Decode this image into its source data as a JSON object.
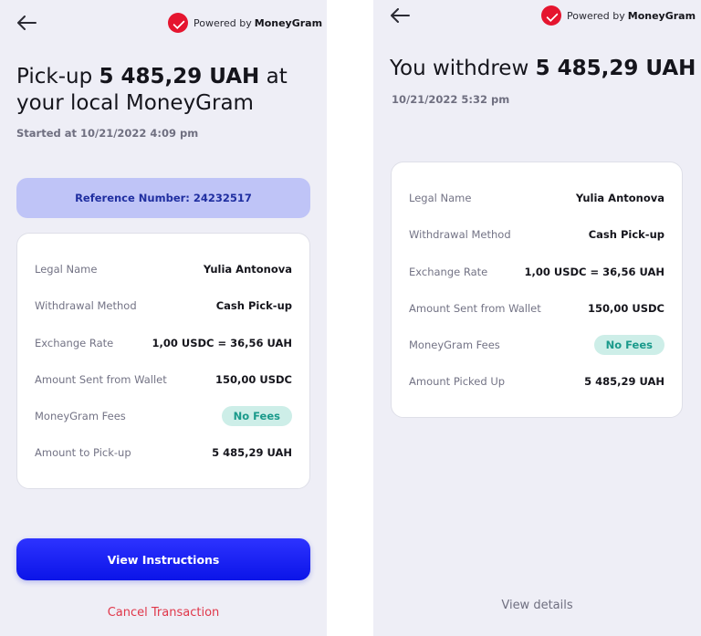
{
  "brand": {
    "powered_by": "Powered by",
    "name": "MoneyGram"
  },
  "left": {
    "title_pre": "Pick-up ",
    "title_amount": "5 485,29 UAH",
    "title_post": " at your local MoneyGram",
    "started": "Started at 10/21/2022 4:09 pm",
    "reference": "Reference Number: 24232517",
    "rows": [
      {
        "label": "Legal Name",
        "value": "Yulia Antonova"
      },
      {
        "label": "Withdrawal Method",
        "value": "Cash Pick-up"
      },
      {
        "label": "Exchange Rate",
        "value": "1,00 USDC = 36,56 UAH"
      },
      {
        "label": "Amount Sent from Wallet",
        "value": "150,00 USDC"
      },
      {
        "label": "MoneyGram Fees",
        "value": "No Fees"
      },
      {
        "label": "Amount to Pick-up",
        "value": "5 485,29 UAH"
      }
    ],
    "primary_button": "View Instructions",
    "cancel_link": "Cancel Transaction"
  },
  "right": {
    "title_pre": "You withdrew ",
    "title_amount": "5 485,29 UAH",
    "date": "10/21/2022 5:32 pm",
    "rows": [
      {
        "label": "Legal Name",
        "value": "Yulia Antonova"
      },
      {
        "label": "Withdrawal Method",
        "value": "Cash Pick-up"
      },
      {
        "label": "Exchange Rate",
        "value": "1,00 USDC = 36,56 UAH"
      },
      {
        "label": "Amount Sent from Wallet",
        "value": "150,00 USDC"
      },
      {
        "label": "MoneyGram Fees",
        "value": "No Fees"
      },
      {
        "label": "Amount Picked Up",
        "value": "5 485,29 UAH"
      }
    ],
    "details_link": "View details"
  },
  "colors": {
    "background": "#eeeef6",
    "primary": "#0b14e8",
    "brand_red": "#e5152f",
    "reference_bg": "#bfc4f7",
    "fee_badge_bg": "#cdeee8",
    "fee_badge_text": "#1a9a8b",
    "cancel": "#e0374a"
  },
  "icons": {
    "back": "arrow-left-icon",
    "logo": "moneygram-logo-icon"
  }
}
